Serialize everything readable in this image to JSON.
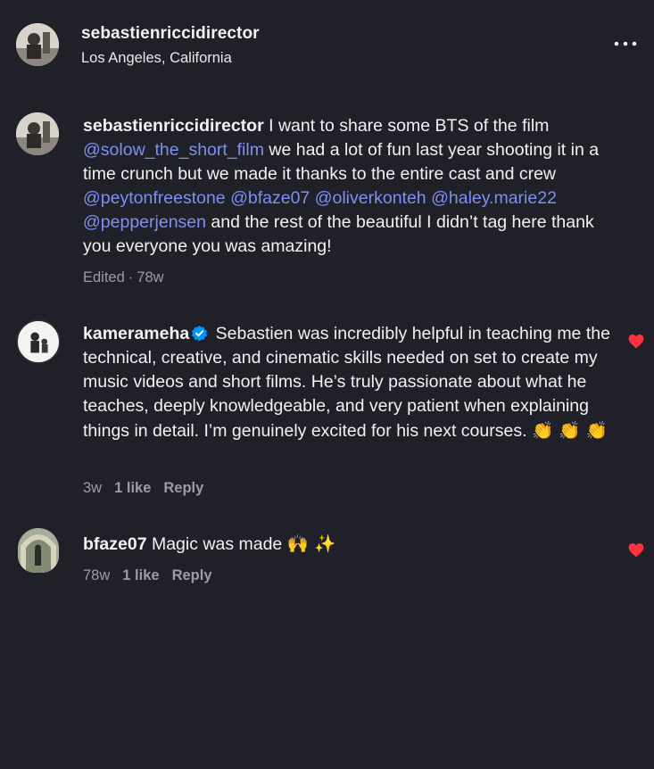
{
  "post_header": {
    "username": "sebastienriccidirector",
    "location": "Los Angeles, California",
    "more_icon": "more-horizontal-icon"
  },
  "caption": {
    "username": "sebastienriccidirector",
    "text_1": " I want to share some BTS of the film ",
    "mention_1": "@solow_the_short_film",
    "text_2": " we had a lot of fun last year shooting it in a time crunch but we made it thanks to the entire cast and crew ",
    "mention_2": "@peytonfreestone",
    "mention_3": "@bfaze07",
    "mention_4": "@oliverkonteh",
    "mention_5": "@haley.marie22",
    "mention_6": "@pepperjensen",
    "text_3": " and the rest of the beautiful I didn’t tag here thank you everyone you was amazing!",
    "edited": "Edited",
    "time": "78w"
  },
  "comments": [
    {
      "username": "kamerameha",
      "verified": true,
      "text": " Sebastien was incredibly helpful in teaching me the technical, creative, and cinematic skills needed on set to create my music videos and short films. He’s truly passionate about what he teaches, deeply knowledgeable, and very patient when explaining things in detail. I’m genuinely excited for his next courses. ",
      "emoji": "👏 👏 👏",
      "time": "3w",
      "likes": "1 like",
      "reply": "Reply",
      "liked": true
    },
    {
      "username": "bfaze07",
      "verified": false,
      "text": " Magic was made ",
      "emoji": "🙌 ✨",
      "time": "78w",
      "likes": "1 like",
      "reply": "Reply",
      "liked": true
    }
  ],
  "colors": {
    "background": "#1f2028",
    "mention": "#7f8ff0",
    "heart": "#ff3040",
    "verified": "#0095f6",
    "meta": "#9c9ca6"
  }
}
